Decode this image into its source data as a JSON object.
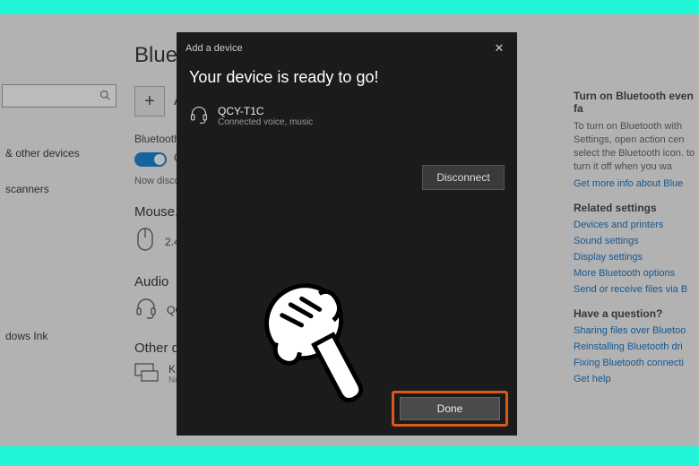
{
  "page": {
    "title": "Bluetooth"
  },
  "sidebar": {
    "search_placeholder": "",
    "items": [
      {
        "label": "& other devices"
      },
      {
        "label": "scanners"
      },
      {
        "label": "dows Ink"
      }
    ]
  },
  "main": {
    "add_label": "Ad",
    "bt_label": "Bluetooth",
    "toggle_state": "On",
    "discover_status": "Now discov",
    "section_mouse": "Mouse,",
    "mouse_device": "2.4",
    "section_audio": "Audio",
    "audio_device": "QC",
    "section_other": "Other d",
    "other_device": "KD",
    "other_sub": "No"
  },
  "dialog": {
    "header": "Add a device",
    "title": "Your device is ready to go!",
    "device_name": "QCY-T1C",
    "device_status": "Connected voice, music",
    "disconnect_label": "Disconnect",
    "done_label": "Done"
  },
  "info": {
    "heading1": "Turn on Bluetooth even fa",
    "body1": "To turn on Bluetooth with Settings, open action cen select the Bluetooth icon. to turn it off when you wa",
    "link_more": "Get more info about Blue",
    "heading2": "Related settings",
    "links2": [
      "Devices and printers",
      "Sound settings",
      "Display settings",
      "More Bluetooth options",
      "Send or receive files via B"
    ],
    "heading3": "Have a question?",
    "links3": [
      "Sharing files over Bluetoo",
      "Reinstalling Bluetooth dri",
      "Fixing Bluetooth connecti",
      "Get help"
    ]
  }
}
